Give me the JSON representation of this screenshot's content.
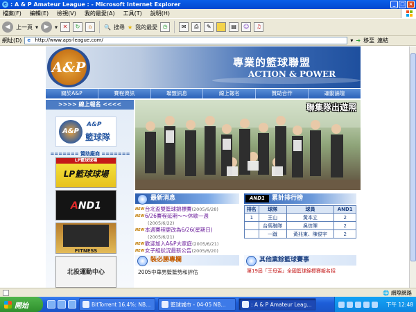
{
  "window": {
    "title": ": A & P Amateur League : - Microsoft Internet Explorer",
    "min": "_",
    "max": "□",
    "close": "×"
  },
  "menu": [
    "檔案(F)",
    "編輯(E)",
    "檢視(V)",
    "我的最愛(A)",
    "工具(T)",
    "說明(H)"
  ],
  "toolbar": {
    "back": "上一頁",
    "search": "搜尋",
    "favorites": "我的最愛"
  },
  "address": {
    "label": "網址(D)",
    "url": "http://www.aps-league.com/",
    "go": "移至",
    "links": "連結"
  },
  "site": {
    "banner_logo": "A&P",
    "banner_title": "專業的籃球聯盟",
    "banner_subtitle": "ACTION & POWER",
    "nav": [
      "關於A&P",
      "賽程資訊",
      "聯盟訊息",
      "線上報名",
      "贊助合作",
      "運動論壇"
    ],
    "signup": ">>>>  線上報名  <<<<",
    "minilogo_ap": "A&P",
    "minilogo_team": "籃球隊",
    "minilogo_ball": "A&P",
    "sponsor_title": "======= 贊助廠商 =======",
    "sponsors": {
      "s1_top": "LP籃球球場",
      "s1_main": "LP籃球球場",
      "s2_brand_a": "A",
      "s2_brand_b": "ND1",
      "s3": "FITNESS",
      "s4": "北投運動中心"
    },
    "photo_caption": "聯集隊出遊照",
    "news": {
      "title": "最新消息",
      "new_badge": "NEW",
      "items": [
        {
          "text": "台北盃雙籃球錦標賽",
          "date": "(2005/6/28)",
          "inline": true
        },
        {
          "text": "6/26賽程延期～～休歇一週",
          "date": "(2005/6/22)"
        },
        {
          "text": "本週賽程更改為6/26(星期日)",
          "date": "(2005/6/21)"
        },
        {
          "text": "歡迎加入A&P大家庭",
          "date": "(2005/6/21)",
          "inline": true
        },
        {
          "text": "女子組狀況最新公告",
          "date": "(2005/6/20)",
          "inline": true
        }
      ]
    },
    "ranking": {
      "logo": "AND1",
      "title": "累計排行榜",
      "headers": [
        "排名",
        "球隊",
        "球員",
        "AND1"
      ],
      "rows": [
        {
          "rank": "1",
          "team": "王山",
          "player": "黃本立",
          "score": "2"
        },
        {
          "rank": "",
          "team": "台馬聯隊",
          "player": "吳信暉",
          "score": "2"
        },
        {
          "rank": "",
          "team": "一蹴",
          "player": "黃兆東、陳俊宇",
          "score": "2"
        }
      ]
    },
    "must": {
      "title": "裝必勝專欄",
      "item": "2005中華男籃籃勢和評估"
    },
    "other": {
      "title": "其他業餘籃球賽事",
      "item": "第19屆「王母盃」全國籃球錦標賽報名招"
    }
  },
  "status": {
    "text": "",
    "zone": "網際網路"
  },
  "taskbar": {
    "start": "開始",
    "tasks": [
      "BitTorrent 16.4%: NB...",
      "籃球城市 - 04-05 NB...",
      ": A & P Amateur Leag..."
    ],
    "clock": "下午 12:48"
  }
}
